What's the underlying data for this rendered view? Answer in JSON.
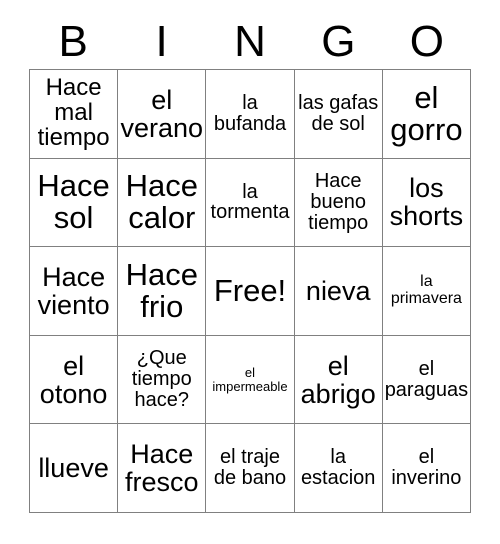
{
  "card": {
    "title": "BINGO",
    "header_letters": [
      "B",
      "I",
      "N",
      "G",
      "O"
    ],
    "columns": 5,
    "rows": 5,
    "free_space_label": "Free!",
    "free_space_position": {
      "row": 3,
      "column": 3
    },
    "border_color": "#808080",
    "text_color": "#000000",
    "background_color": "#ffffff",
    "cells": [
      {
        "text": "Hace mal tiempo",
        "size": "lg"
      },
      {
        "text": "el verano",
        "size": "xl"
      },
      {
        "text": "la bufanda",
        "size": "md"
      },
      {
        "text": "las gafas de sol",
        "size": "md"
      },
      {
        "text": "el gorro",
        "size": "xxl"
      },
      {
        "text": "Hace sol",
        "size": "xxl"
      },
      {
        "text": "Hace calor",
        "size": "xxl"
      },
      {
        "text": "la tormenta",
        "size": "md"
      },
      {
        "text": "Hace bueno tiempo",
        "size": "md"
      },
      {
        "text": "los shorts",
        "size": "xl"
      },
      {
        "text": "Hace viento",
        "size": "xl"
      },
      {
        "text": "Hace frio",
        "size": "xxl"
      },
      {
        "text": "Free!",
        "size": "xxl"
      },
      {
        "text": "nieva",
        "size": "xl"
      },
      {
        "text": "la primavera",
        "size": "sm"
      },
      {
        "text": "el otono",
        "size": "xl"
      },
      {
        "text": "¿Que tiempo hace?",
        "size": "md"
      },
      {
        "text": "el impermeable",
        "size": "xs"
      },
      {
        "text": "el abrigo",
        "size": "xl"
      },
      {
        "text": "el paraguas",
        "size": "md"
      },
      {
        "text": "llueve",
        "size": "xl"
      },
      {
        "text": "Hace fresco",
        "size": "xl"
      },
      {
        "text": "el traje de bano",
        "size": "md"
      },
      {
        "text": "la estacion",
        "size": "md"
      },
      {
        "text": "el inverino",
        "size": "md"
      }
    ]
  }
}
